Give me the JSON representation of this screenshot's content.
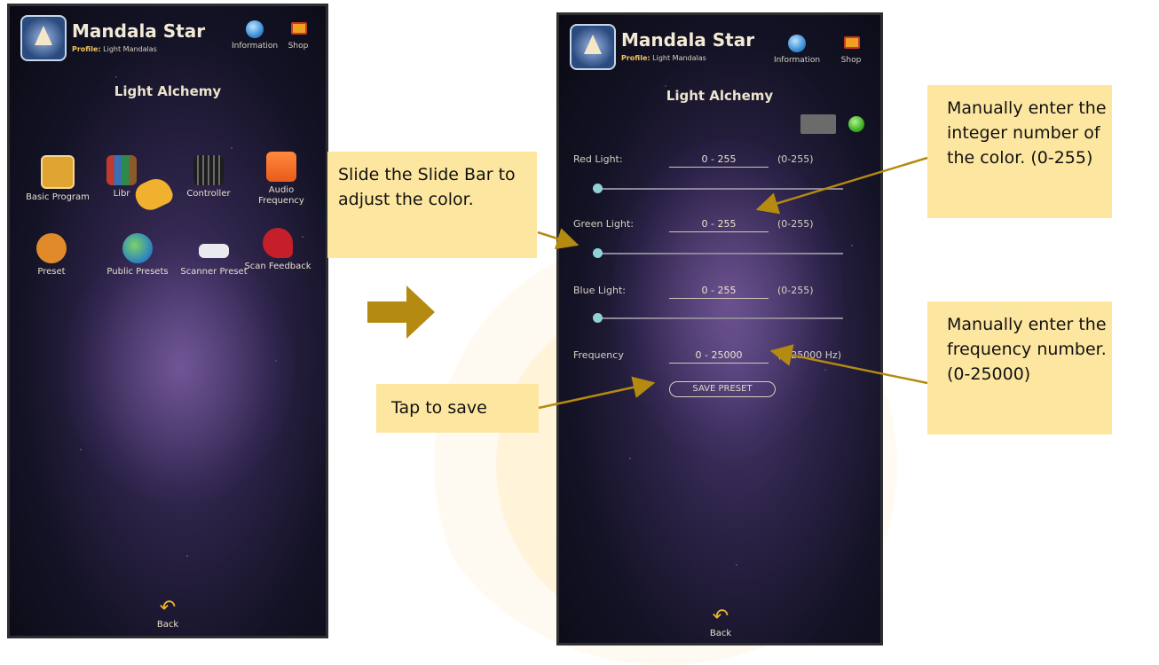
{
  "left_phone": {
    "app_title": "Mandala Star",
    "profile_label": "Profile:",
    "profile_value": "Light Mandalas",
    "info_label": "Information",
    "shop_label": "Shop",
    "section_title": "Light Alchemy",
    "grid_items": [
      {
        "label": "Basic Program",
        "icon": "touch-icon"
      },
      {
        "label": "Libr",
        "icon": "books-icon"
      },
      {
        "label": "Controller",
        "icon": "controller-icon"
      },
      {
        "label": "Audio Frequency",
        "icon": "music-icon"
      },
      {
        "label": "Preset",
        "icon": "sliders-icon"
      },
      {
        "label": "Public Presets",
        "icon": "globe-icon"
      },
      {
        "label": "Scanner Preset",
        "icon": "scanner-icon"
      },
      {
        "label": "Scan Feedback",
        "icon": "heart-scan-icon"
      }
    ],
    "back_label": "Back"
  },
  "right_phone": {
    "app_title": "Mandala Star",
    "profile_label": "Profile:",
    "profile_value": "Light Mandalas",
    "info_label": "Information",
    "shop_label": "Shop",
    "section_title": "Light Alchemy",
    "rows": [
      {
        "label": "Red Light:",
        "placeholder": "0 - 255",
        "range": "(0-255)",
        "slider_value": 0
      },
      {
        "label": "Green Light:",
        "placeholder": "0 - 255",
        "range": "(0-255)",
        "slider_value": 0
      },
      {
        "label": "Blue Light:",
        "placeholder": "0 - 255",
        "range": "(0-255)",
        "slider_value": 0
      }
    ],
    "frequency": {
      "label": "Frequency",
      "placeholder": "0 - 25000",
      "range": "(0-25000 Hz)"
    },
    "save_button": "SAVE PRESET",
    "back_label": "Back"
  },
  "callouts": {
    "slide": "Slide the Slide Bar to adjust the color.",
    "color_input": "Manually enter the integer number of the color. (0-255)",
    "frequency_input": "Manually enter the frequency number. (0-25000)",
    "save": "Tap to save"
  },
  "colors": {
    "callout_bg": "#fde6a0",
    "arrow": "#b58a10",
    "accent": "#f1b82b"
  }
}
